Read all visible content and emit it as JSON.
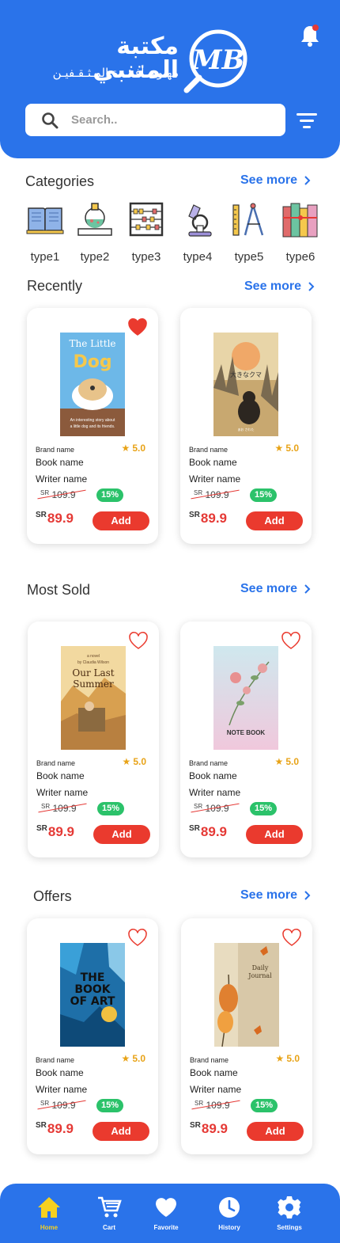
{
  "header": {
    "app_name_ar": "مكتبة المتنبي",
    "tagline_ar": "مهـوى أفـئـدة المـثـقـفيـن",
    "logo_initials": "MB",
    "bell_icon": "bell-icon",
    "filter_icon": "filter-icon"
  },
  "search": {
    "placeholder": "Search..",
    "value": ""
  },
  "categories": {
    "title": "Categories",
    "see_more": "See more",
    "items": [
      {
        "label": "type1",
        "icon": "open-book-icon"
      },
      {
        "label": "type2",
        "icon": "chemistry-icon"
      },
      {
        "label": "type3",
        "icon": "abacus-icon"
      },
      {
        "label": "type4",
        "icon": "microscope-icon"
      },
      {
        "label": "type5",
        "icon": "geometry-tools-icon"
      },
      {
        "label": "type6",
        "icon": "books-gift-icon"
      }
    ]
  },
  "recently": {
    "title": "Recently",
    "see_more": "See more",
    "products": [
      {
        "brand": "Brand name",
        "rating": "5.0",
        "name": "Book name",
        "writer": "Writer name",
        "currency": "SR",
        "old_price": "109.9",
        "discount": "15%",
        "price": "89.9",
        "add": "Add",
        "favorite": true,
        "cover_title": "The Little Dog",
        "cover_sub": "An interesting story about a little dog and its friends"
      },
      {
        "brand": "Brand name",
        "rating": "5.0",
        "name": "Book name",
        "writer": "Writer name",
        "currency": "SR",
        "old_price": "109.9",
        "discount": "15%",
        "price": "89.9",
        "add": "Add",
        "favorite": false,
        "cover_title": "大きなクマ"
      }
    ]
  },
  "most_sold": {
    "title": "Most Sold",
    "see_more": "See more",
    "products": [
      {
        "brand": "Brand name",
        "rating": "5.0",
        "name": "Book name",
        "writer": "Writer name",
        "currency": "SR",
        "old_price": "109.9",
        "discount": "15%",
        "price": "89.9",
        "add": "Add",
        "favorite": false,
        "cover_title": "Our Last Summer"
      },
      {
        "brand": "Brand name",
        "rating": "5.0",
        "name": "Book name",
        "writer": "Writer name",
        "currency": "SR",
        "old_price": "109.9",
        "discount": "15%",
        "price": "89.9",
        "add": "Add",
        "favorite": false,
        "cover_title": "NOTE BOOK"
      }
    ]
  },
  "offers": {
    "title": "Offers",
    "see_more": "See more",
    "products": [
      {
        "brand": "Brand name",
        "rating": "5.0",
        "name": "Book name",
        "writer": "Writer name",
        "currency": "SR",
        "old_price": "109.9",
        "discount": "15%",
        "price": "89.9",
        "add": "Add",
        "favorite": false,
        "cover_title": "THE BOOK OF ART"
      },
      {
        "brand": "Brand name",
        "rating": "5.0",
        "name": "Book name",
        "writer": "Writer name",
        "currency": "SR",
        "old_price": "109.9",
        "discount": "15%",
        "price": "89.9",
        "add": "Add",
        "favorite": false,
        "cover_title": "Daily Journal"
      }
    ]
  },
  "nav": {
    "items": [
      {
        "label": "Home",
        "icon": "home-icon"
      },
      {
        "label": "Cart",
        "icon": "cart-icon"
      },
      {
        "label": "Favorite",
        "icon": "heart-icon"
      },
      {
        "label": "History",
        "icon": "clock-icon"
      },
      {
        "label": "Settings",
        "icon": "gear-icon"
      }
    ]
  },
  "colors": {
    "primary": "#2A73EA",
    "accent_red": "#EA3A2E",
    "discount_green": "#2BC26A",
    "star": "#E8A317"
  }
}
